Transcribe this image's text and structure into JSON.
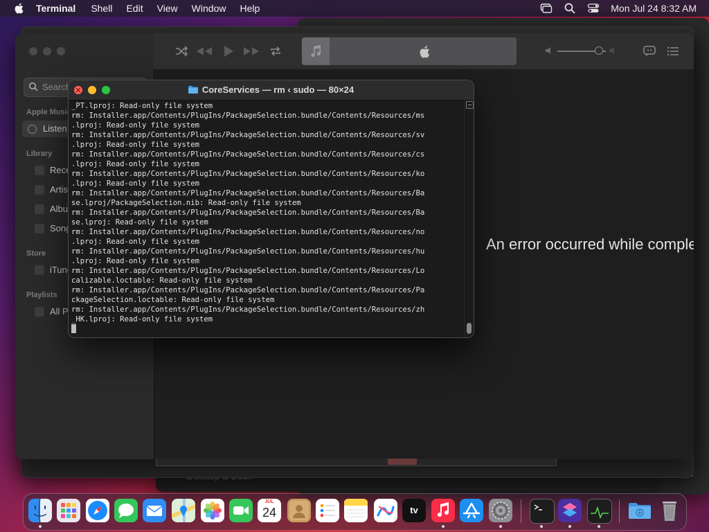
{
  "menubar": {
    "app_name": "Terminal",
    "menus": [
      "Shell",
      "Edit",
      "View",
      "Window",
      "Help"
    ],
    "clock": "Mon Jul 24  8:32 AM"
  },
  "music": {
    "search_placeholder": "Search",
    "sidebar": {
      "apple_music_heading": "Apple Music",
      "listen_now": "Listen Now",
      "library_heading": "Library",
      "library_items": [
        "Recently Added",
        "Artists",
        "Albums",
        "Songs"
      ],
      "store_heading": "Store",
      "store_items": [
        "iTunes Store"
      ],
      "playlists_heading": "Playlists",
      "playlist_items": [
        "All Playlists"
      ]
    },
    "status_message": "An error occurred while completing your request."
  },
  "settings_row_label": "Desktop & Dock",
  "terminal": {
    "title": "CoreServices — rm ‹ sudo — 80×24",
    "lines": [
      "_PT.lproj: Read-only file system",
      "rm: Installer.app/Contents/PlugIns/PackageSelection.bundle/Contents/Resources/ms",
      ".lproj: Read-only file system",
      "rm: Installer.app/Contents/PlugIns/PackageSelection.bundle/Contents/Resources/sv",
      ".lproj: Read-only file system",
      "rm: Installer.app/Contents/PlugIns/PackageSelection.bundle/Contents/Resources/cs",
      ".lproj: Read-only file system",
      "rm: Installer.app/Contents/PlugIns/PackageSelection.bundle/Contents/Resources/ko",
      ".lproj: Read-only file system",
      "rm: Installer.app/Contents/PlugIns/PackageSelection.bundle/Contents/Resources/Ba",
      "se.lproj/PackageSelection.nib: Read-only file system",
      "rm: Installer.app/Contents/PlugIns/PackageSelection.bundle/Contents/Resources/Ba",
      "se.lproj: Read-only file system",
      "rm: Installer.app/Contents/PlugIns/PackageSelection.bundle/Contents/Resources/no",
      ".lproj: Read-only file system",
      "rm: Installer.app/Contents/PlugIns/PackageSelection.bundle/Contents/Resources/hu",
      ".lproj: Read-only file system",
      "rm: Installer.app/Contents/PlugIns/PackageSelection.bundle/Contents/Resources/Lo",
      "calizable.loctable: Read-only file system",
      "rm: Installer.app/Contents/PlugIns/PackageSelection.bundle/Contents/Resources/Pa",
      "ckageSelection.loctable: Read-only file system",
      "rm: Installer.app/Contents/PlugIns/PackageSelection.bundle/Contents/Resources/zh",
      "_HK.lproj: Read-only file system"
    ]
  },
  "dock": {
    "apps": [
      {
        "name": "finder-icon",
        "color": "#2f8cf0"
      },
      {
        "name": "launchpad-icon",
        "color": "#e8e8ec"
      },
      {
        "name": "safari-icon",
        "color": "#1a8cff"
      },
      {
        "name": "messages-icon",
        "color": "#34c759"
      },
      {
        "name": "mail-icon",
        "color": "#2e8ef5"
      },
      {
        "name": "maps-icon",
        "color": "#5ac05a"
      },
      {
        "name": "photos-icon",
        "color": "#ffffff"
      },
      {
        "name": "facetime-icon",
        "color": "#34c759"
      },
      {
        "name": "calendar-icon",
        "color": "#ffffff"
      },
      {
        "name": "contacts-icon",
        "color": "#c89a5f"
      },
      {
        "name": "reminders-icon",
        "color": "#ffffff"
      },
      {
        "name": "notes-icon",
        "color": "#ffd64a"
      },
      {
        "name": "freeform-icon",
        "color": "#ffffff"
      },
      {
        "name": "apple-tv-icon",
        "color": "#111111"
      },
      {
        "name": "music-icon",
        "color": "#fa2d48"
      },
      {
        "name": "app-store-icon",
        "color": "#1f8ef1"
      },
      {
        "name": "system-settings-icon",
        "color": "#8e8e93"
      },
      {
        "name": "terminal-icon",
        "color": "#1d1d1d"
      },
      {
        "name": "shortcuts-icon",
        "color": "#4a2fa0"
      },
      {
        "name": "activity-monitor-icon",
        "color": "#1d1d1d"
      },
      {
        "name": "downloads-folder-icon",
        "color": "#4fa3e8"
      },
      {
        "name": "trash-icon",
        "color": "#8a8a8e"
      }
    ],
    "calendar": {
      "month": "JUL",
      "day": "24"
    },
    "tv_label": "tv"
  }
}
